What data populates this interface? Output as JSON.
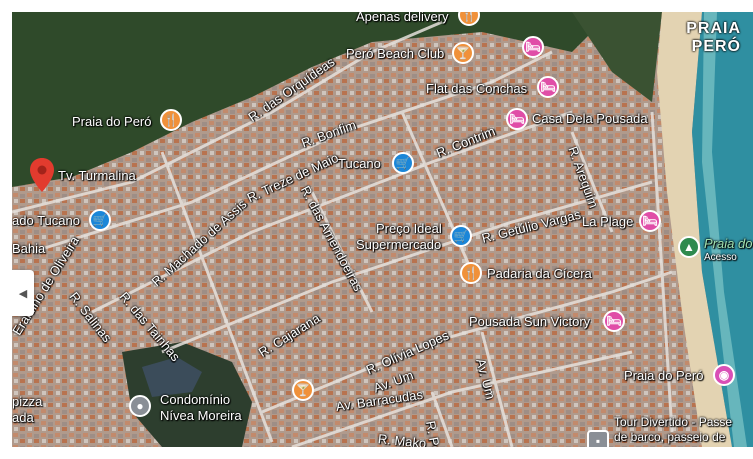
{
  "map": {
    "corner_label": [
      "PRAIA",
      "PERÓ"
    ],
    "places": [
      {
        "id": "apenas-delivery",
        "name": "Apenas delivery",
        "type": "food"
      },
      {
        "id": "pero-beach-club",
        "name": "Peró Beach Club",
        "type": "food"
      },
      {
        "id": "flat-das-conchas",
        "name": "Flat das Conchas",
        "type": "hotel"
      },
      {
        "id": "casa-dela-pousada",
        "name": "Casa Dela Pousada",
        "type": "hotel"
      },
      {
        "id": "praia-do-pero-food",
        "name": "Praia do Peró",
        "type": "food"
      },
      {
        "id": "tucano",
        "name": "Tucano",
        "type": "shop"
      },
      {
        "id": "tv-turmalina",
        "name": "Tv. Turmalina",
        "type": "pin"
      },
      {
        "id": "mercado-tucano",
        "name": "ado Tucano",
        "type": "shop"
      },
      {
        "id": "preco-ideal",
        "name": [
          "Preço Ideal",
          "Supermercado"
        ],
        "type": "shop"
      },
      {
        "id": "la-plage",
        "name": "La Plage",
        "type": "hotel"
      },
      {
        "id": "praia-do-pero-park",
        "name": [
          "Praia do",
          "Acesso"
        ],
        "type": "park"
      },
      {
        "id": "padaria-da-cicera",
        "name": "Padaria da Cícera",
        "type": "food"
      },
      {
        "id": "pousada-sun-victory",
        "name": "Pousada Sun Victory",
        "type": "hotel"
      },
      {
        "id": "praia-do-pero-photo",
        "name": "Praia do Peró",
        "type": "photo"
      },
      {
        "id": "condominio-nivea",
        "name": [
          "Condomínio",
          "Nívea Moreira"
        ],
        "type": "place"
      },
      {
        "id": "pizza",
        "name": [
          "pizza",
          "ada"
        ],
        "type": "food"
      },
      {
        "id": "tour-divertido",
        "name": [
          "Tour Divertido - Passe",
          "de barco, passeio de"
        ],
        "type": "gray"
      }
    ],
    "streets": {
      "orquideas": "R. das Orquídeas",
      "bonfim": "R. Bonfim",
      "contrim": "R. Contrim",
      "arequim": "R. Arequim",
      "treze_maio": "R. Treze de Maio",
      "amendoeiras": "R. das Amendoeiras",
      "getulio": "R. Getúlio Vargas",
      "machado": "R. Machado de Assis",
      "bahia": "Bahia",
      "eraldino": "Eraldino de Oliveira",
      "salinas": "R. Salinas",
      "tainhas": "R. das Tainhas",
      "cajarana": "R. Cajarana",
      "olivia": "R. Olívia Lopes",
      "av_um_1": "Av. Um",
      "av_um_2": "Av. Um",
      "barracudas": "Av. Barracudas",
      "mako": "R. Mako",
      "pe": "R. Pe"
    }
  }
}
